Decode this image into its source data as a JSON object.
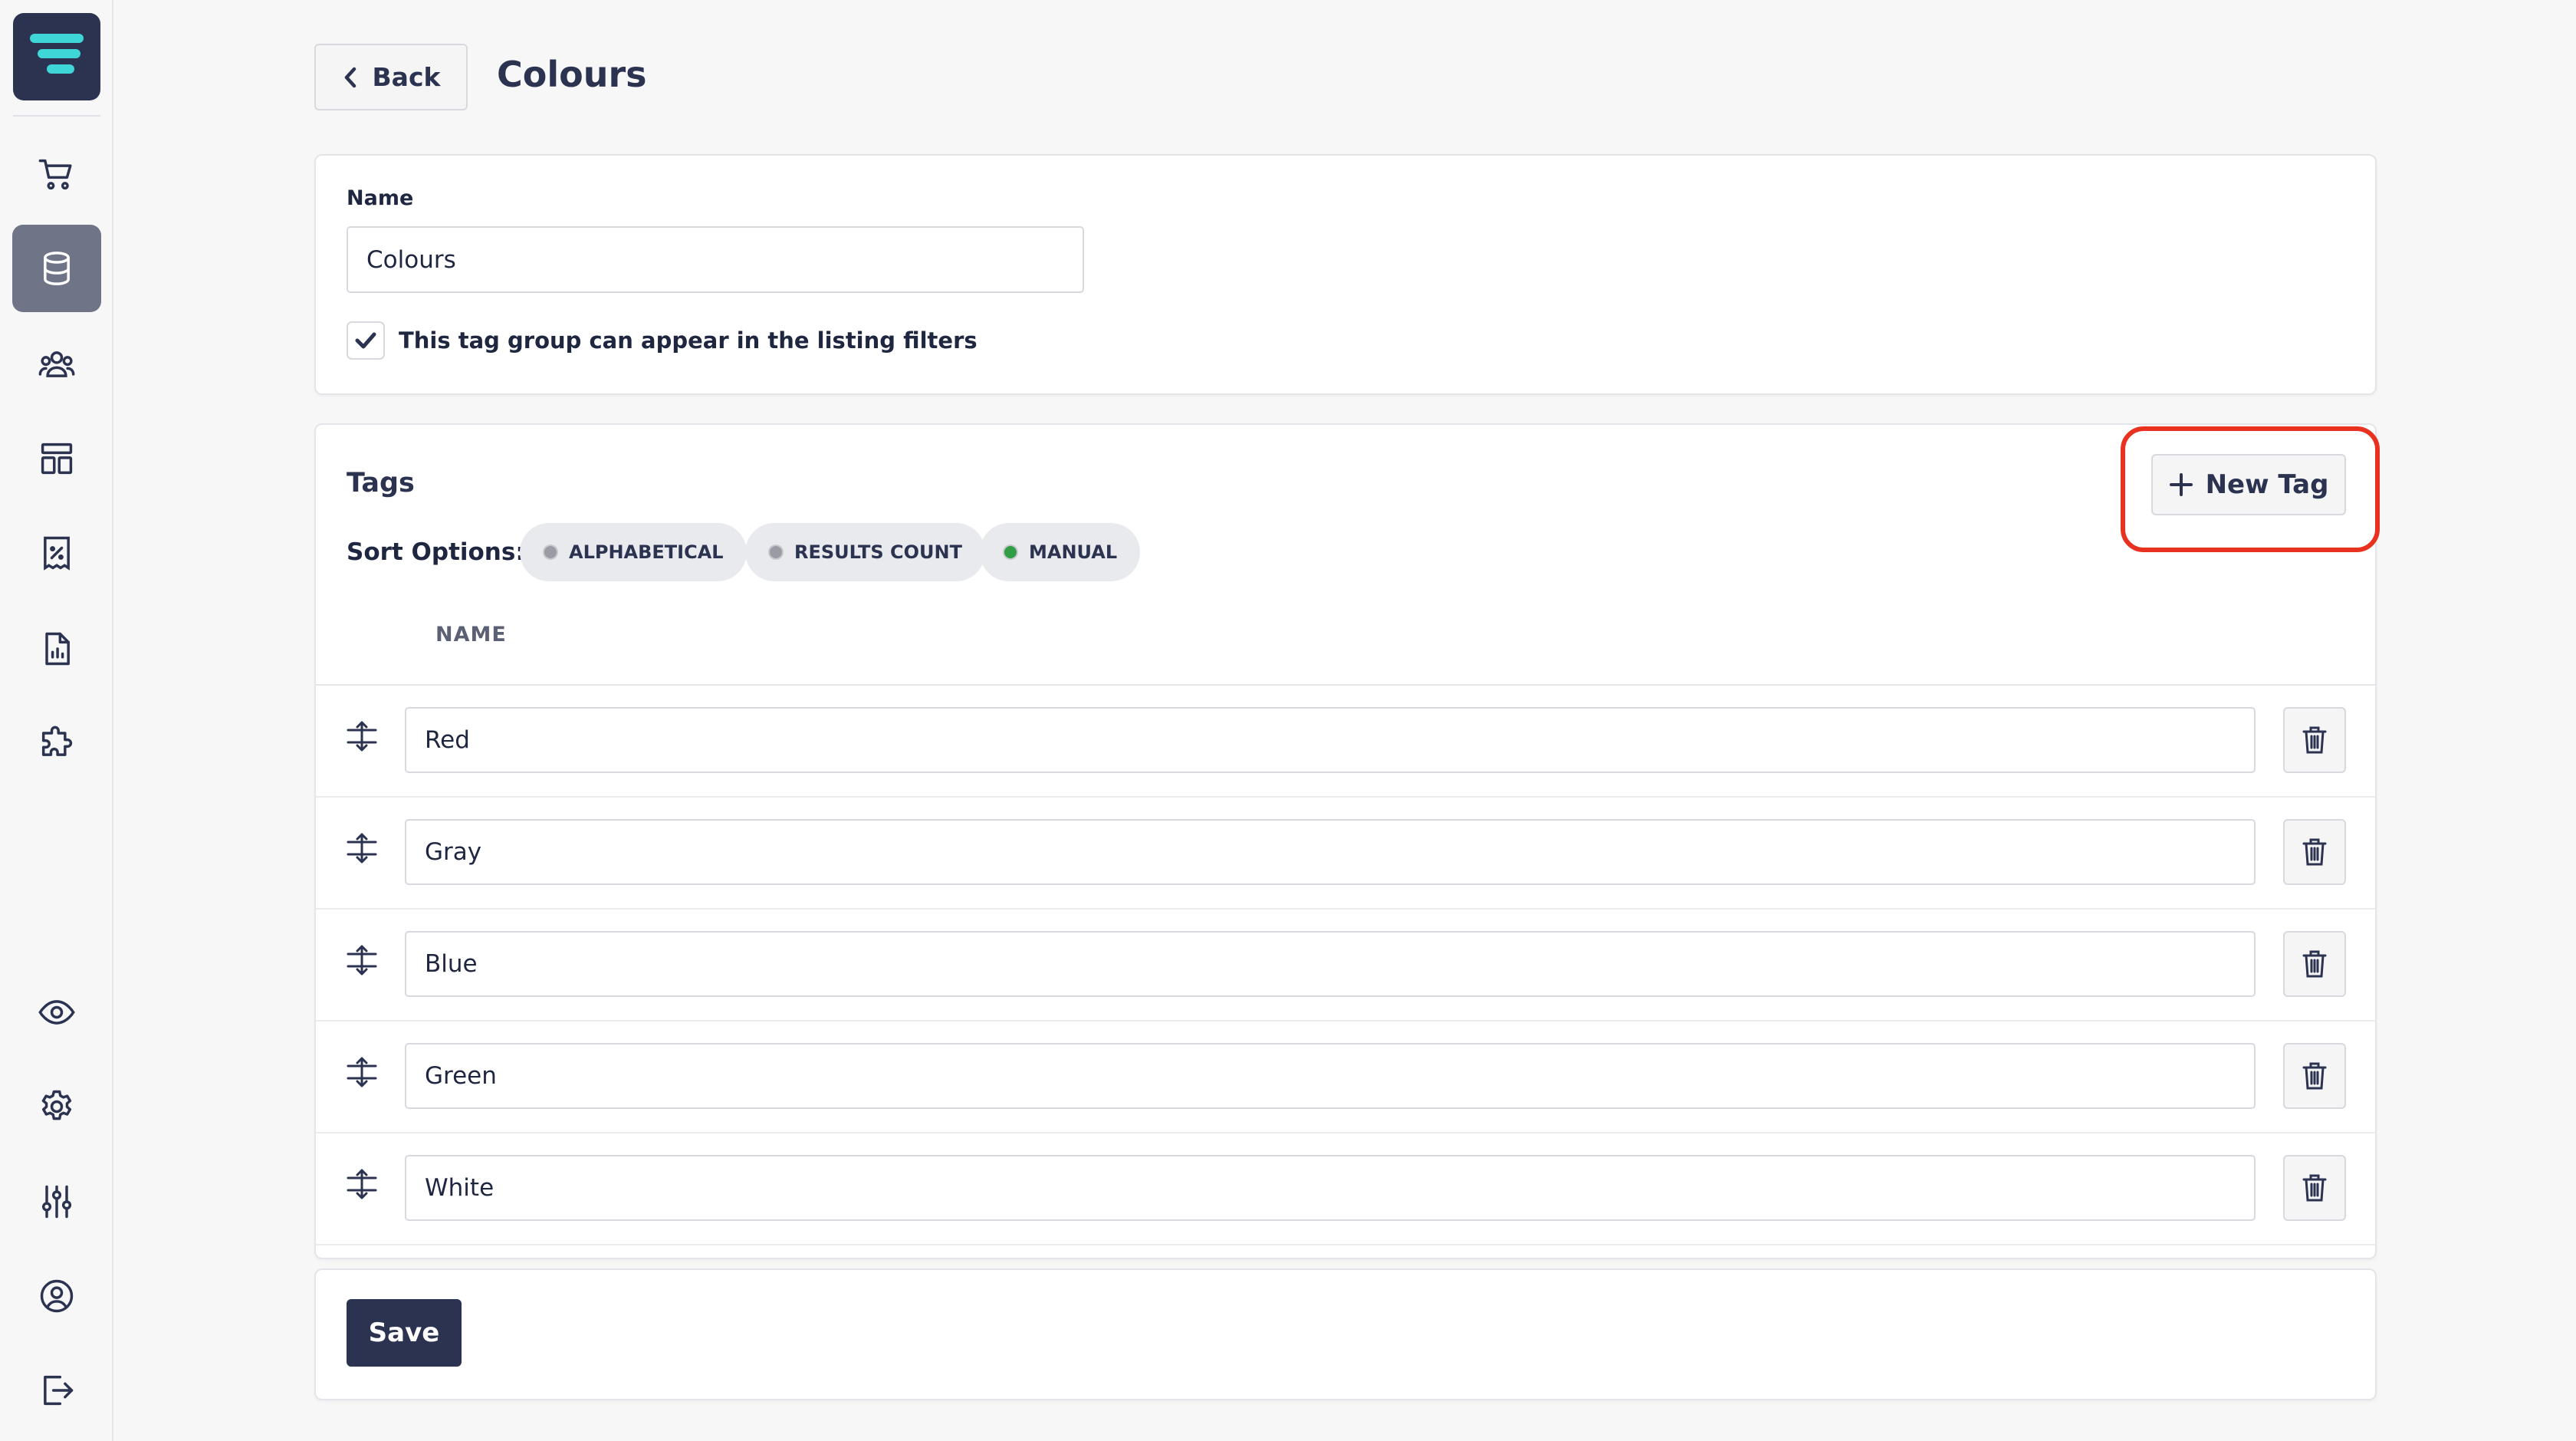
{
  "header": {
    "back_label": "Back",
    "page_title": "Colours"
  },
  "details": {
    "name_label": "Name",
    "name_value": "Colours",
    "filters_checkbox_label": "This tag group can appear in the listing filters",
    "filters_checked": true
  },
  "tags": {
    "title": "Tags",
    "new_tag_label": "New Tag",
    "sort_label": "Sort Options:",
    "sort_options": [
      {
        "label": "ALPHABETICAL",
        "active": false
      },
      {
        "label": "RESULTS COUNT",
        "active": false
      },
      {
        "label": "MANUAL",
        "active": true
      }
    ],
    "column_header": "NAME",
    "rows": [
      {
        "value": "Red"
      },
      {
        "value": "Gray"
      },
      {
        "value": "Blue"
      },
      {
        "value": "Green"
      },
      {
        "value": "White"
      }
    ]
  },
  "footer": {
    "save_label": "Save"
  },
  "sidebar": {
    "icons": [
      "cart-icon",
      "database-icon",
      "users-icon",
      "layout-icon",
      "discount-receipt-icon",
      "report-icon",
      "puzzle-icon",
      "eye-icon",
      "gear-icon",
      "sliders-icon",
      "user-circle-icon",
      "logout-icon"
    ]
  },
  "colors": {
    "primary": "#2b3350",
    "highlight": "#e8321f",
    "active_dot": "#2f9e44",
    "inactive_dot": "#9a9ca4",
    "logo_accent": "#3ed6d6"
  }
}
